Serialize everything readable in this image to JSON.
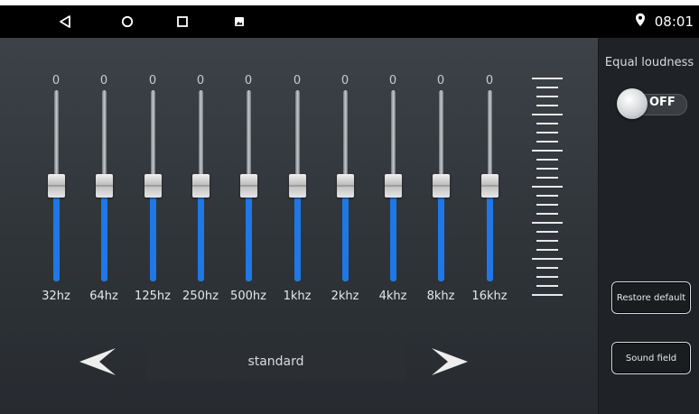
{
  "status_bar": {
    "nav_icons": [
      "back-icon",
      "home-icon",
      "recents-icon",
      "gallery-icon"
    ],
    "location_icon": "location-pin-icon",
    "time": "08:01"
  },
  "equalizer": {
    "bands": [
      {
        "value": "0",
        "freq": "32hz",
        "level": 0.5
      },
      {
        "value": "0",
        "freq": "64hz",
        "level": 0.5
      },
      {
        "value": "0",
        "freq": "125hz",
        "level": 0.5
      },
      {
        "value": "0",
        "freq": "250hz",
        "level": 0.5
      },
      {
        "value": "0",
        "freq": "500hz",
        "level": 0.5
      },
      {
        "value": "0",
        "freq": "1khz",
        "level": 0.5
      },
      {
        "value": "0",
        "freq": "2khz",
        "level": 0.5
      },
      {
        "value": "0",
        "freq": "4khz",
        "level": 0.5
      },
      {
        "value": "0",
        "freq": "8khz",
        "level": 0.5
      },
      {
        "value": "0",
        "freq": "16khz",
        "level": 0.5
      }
    ],
    "preset": "standard"
  },
  "side_panel": {
    "equal_loudness_label": "Equal loudness",
    "toggle_state": "OFF",
    "restore_default_label": "Restore default",
    "sound_field_label": "Sound field"
  },
  "colors": {
    "fill_blue": "#1e78e6",
    "panel_dark": "#1f2327"
  }
}
